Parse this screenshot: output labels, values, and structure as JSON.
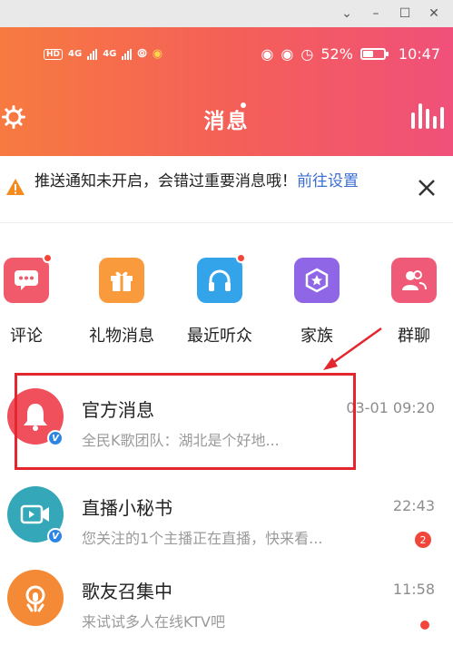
{
  "status_bar": {
    "hd": "HD",
    "net1": "4G",
    "net2": "4G",
    "battery_percent": "52%",
    "battery_level": 0.52,
    "time": "10:47"
  },
  "header": {
    "title": "消息"
  },
  "notice": {
    "text": "推送通知未开启，会错过重要消息哦！",
    "link": "前往设置"
  },
  "quick_entries": [
    {
      "label": "评论",
      "icon": "comment-icon",
      "color": "#f05a6a",
      "has_dot": true
    },
    {
      "label": "礼物消息",
      "icon": "gift-icon",
      "color": "#f99a3c",
      "has_dot": false
    },
    {
      "label": "最近听众",
      "icon": "headphones-icon",
      "color": "#33a3ea",
      "has_dot": true
    },
    {
      "label": "家族",
      "icon": "family-shield-icon",
      "color": "#8e66e6",
      "has_dot": false
    },
    {
      "label": "群聊",
      "icon": "group-chat-icon",
      "color": "#ef5a78",
      "has_dot": false
    }
  ],
  "messages": [
    {
      "name": "官方消息",
      "preview": "全民K歌团队：湖北是个好地...",
      "time": "03-01 09:20",
      "avatar_color": "#f04f5c",
      "verified": true,
      "badge": "",
      "dot": false
    },
    {
      "name": "直播小秘书",
      "preview": "您关注的1个主播正在直播，快来看...",
      "time": "22:43",
      "avatar_color": "#34a7b8",
      "verified": true,
      "badge": "2",
      "dot": false
    },
    {
      "name": "歌友召集中",
      "preview": "来试试多人在线KTV吧",
      "time": "11:58",
      "avatar_color": "#f58a36",
      "verified": false,
      "badge": "",
      "dot": true
    }
  ],
  "colors": {
    "header_start": "#f77a40",
    "header_end": "#f0507a",
    "link": "#3b6fd0",
    "badge": "#f2463a",
    "annotation": "#e4262f"
  }
}
